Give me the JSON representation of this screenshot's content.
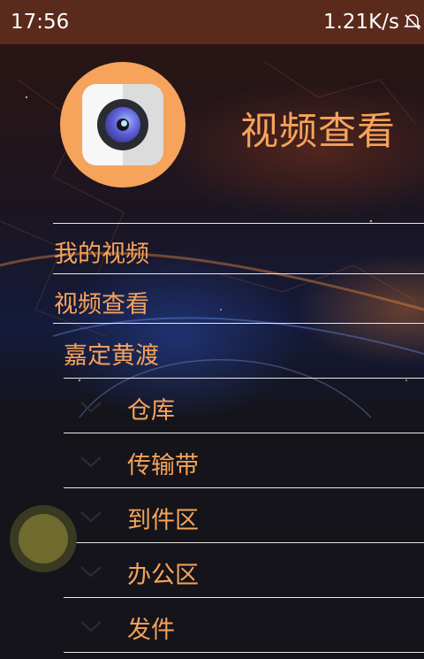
{
  "status_bar": {
    "time": "17:56",
    "network_speed": "1.21K/s",
    "icon": "mute-bell-icon"
  },
  "header": {
    "app_title": "视频查看",
    "logo_icon": "camera-lens-icon",
    "accent_color": "#f6a35b"
  },
  "menu": {
    "items": [
      {
        "label": "我的视频"
      },
      {
        "label": "视频查看"
      }
    ],
    "group": {
      "label": "嘉定黄渡",
      "children": [
        {
          "label": "仓库",
          "icon": "chevron-down-icon"
        },
        {
          "label": "传输带",
          "icon": "chevron-down-icon"
        },
        {
          "label": "到件区",
          "icon": "chevron-down-icon"
        },
        {
          "label": "办公区",
          "icon": "chevron-down-icon"
        },
        {
          "label": "发件",
          "icon": "chevron-down-icon"
        }
      ]
    }
  },
  "floating_button": {
    "icon": "assistive-touch-icon"
  }
}
